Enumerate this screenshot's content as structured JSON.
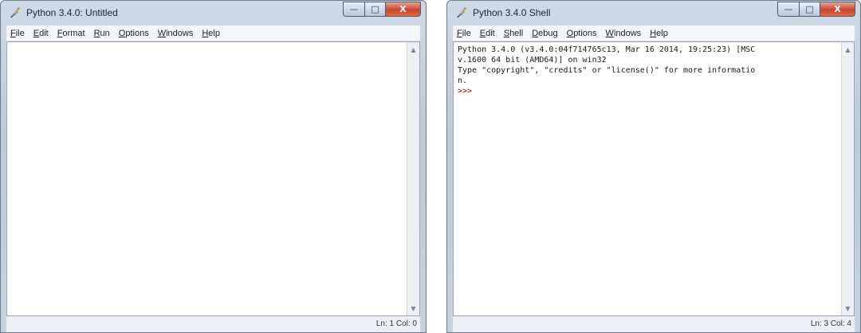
{
  "left_window": {
    "title": "Python 3.4.0: Untitled",
    "menu": [
      {
        "mnemonic": "F",
        "rest": "ile"
      },
      {
        "mnemonic": "E",
        "rest": "dit"
      },
      {
        "mnemonic": "F",
        "rest": "ormat"
      },
      {
        "mnemonic": "R",
        "rest": "un"
      },
      {
        "mnemonic": "O",
        "rest": "ptions"
      },
      {
        "mnemonic": "W",
        "rest": "indows"
      },
      {
        "mnemonic": "H",
        "rest": "elp"
      }
    ],
    "status": "Ln: 1 Col: 0"
  },
  "right_window": {
    "title": "Python 3.4.0 Shell",
    "menu": [
      {
        "mnemonic": "F",
        "rest": "ile"
      },
      {
        "mnemonic": "E",
        "rest": "dit"
      },
      {
        "mnemonic": "S",
        "rest": "hell"
      },
      {
        "mnemonic": "D",
        "rest": "ebug"
      },
      {
        "mnemonic": "O",
        "rest": "ptions"
      },
      {
        "mnemonic": "W",
        "rest": "indows"
      },
      {
        "mnemonic": "H",
        "rest": "elp"
      }
    ],
    "shell_lines": [
      "Python 3.4.0 (v3.4.0:04f714765c13, Mar 16 2014, 19:25:23) [MSC",
      "v.1600 64 bit (AMD64)] on win32",
      "Type \"copyright\", \"credits\" or \"license()\" for more informatio",
      "n."
    ],
    "prompt": ">>>",
    "status": "Ln: 3 Col: 4"
  },
  "colors": {
    "prompt": "#8b0000",
    "close_button": "#c8452d"
  },
  "icons": {
    "app": "python-feather-icon",
    "minimize": "minimize-icon",
    "maximize": "maximize-icon",
    "close": "close-icon",
    "scroll_up": "chevron-up-icon",
    "scroll_down": "chevron-down-icon"
  }
}
